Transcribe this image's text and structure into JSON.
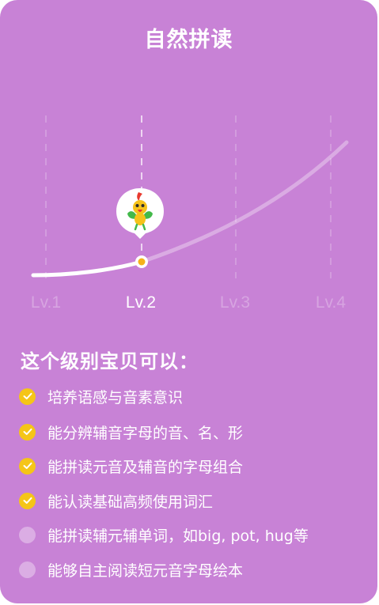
{
  "card": {
    "title": "自然拼读",
    "levels": [
      {
        "label": "Lv.1",
        "active": false
      },
      {
        "label": "Lv.2",
        "active": true
      },
      {
        "label": "Lv.3",
        "active": false
      },
      {
        "label": "Lv.4",
        "active": false
      }
    ],
    "current_level": "Lv.2",
    "avatar": "parrot-mascot-icon",
    "heading": "这个级别宝贝可以：",
    "abilities": [
      {
        "text": "培养语感与音素意识",
        "achieved": true
      },
      {
        "text": "能分辨辅音字母的音、名、形",
        "achieved": true
      },
      {
        "text": "能拼读元音及辅音的字母组合",
        "achieved": true
      },
      {
        "text": "能认读基础高频使用词汇",
        "achieved": true
      },
      {
        "text": "能拼读辅元辅单词，如big, pot, hug等",
        "achieved": false
      },
      {
        "text": "能够自主阅读短元音字母绘本",
        "achieved": false
      }
    ]
  },
  "colors": {
    "background": "#c882d6",
    "accent": "#f5c518",
    "text": "#ffffff"
  }
}
